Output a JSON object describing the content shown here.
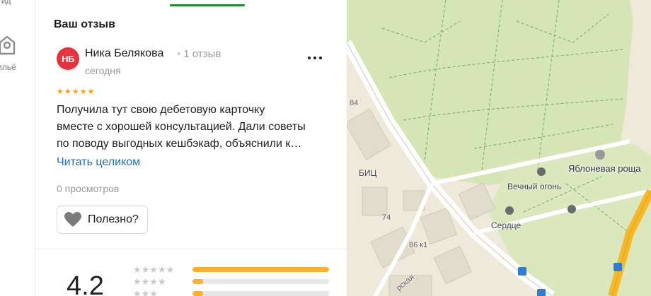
{
  "rail": {
    "top_label": "Гид",
    "bottom_label": "ильё"
  },
  "review": {
    "section_title": "Ваш отзыв",
    "author": {
      "initials": "НБ",
      "name": "Ника Белякова",
      "reviews_count": "1 отзыв"
    },
    "date": "сегодня",
    "rating": 5,
    "text_lines": [
      "Получила тут свою дебетовую карточку",
      "вместе с хорошей консультацией. Дали советы",
      "по поводу выгодных кешбэкаф, объяснили к…"
    ],
    "read_more": "Читать целиком",
    "views": "0 просмотров",
    "useful_label": "Полезно?"
  },
  "summary": {
    "overall": "4.2",
    "distribution": [
      {
        "stars": 5,
        "fraction": 1.0
      },
      {
        "stars": 4,
        "fraction": 0.08
      },
      {
        "stars": 3,
        "fraction": 0.08
      }
    ]
  },
  "map": {
    "labels": {
      "park": "Яблоневая роща",
      "eternal_flame": "Вечный огонь",
      "heart": "Сердце",
      "bic": "БИЦ",
      "house_84": "84",
      "house_74": "74",
      "house_86k1": "86 к1",
      "street": "рская"
    }
  },
  "colors": {
    "accent_green": "#1a8e2f",
    "link_blue": "#1f6eb6",
    "avatar_red": "#e8323c",
    "star_orange": "#fc9c17",
    "bar_yellow": "#fcb02b",
    "park_green": "#d6e5b5",
    "road_yellow": "#f7b827"
  }
}
